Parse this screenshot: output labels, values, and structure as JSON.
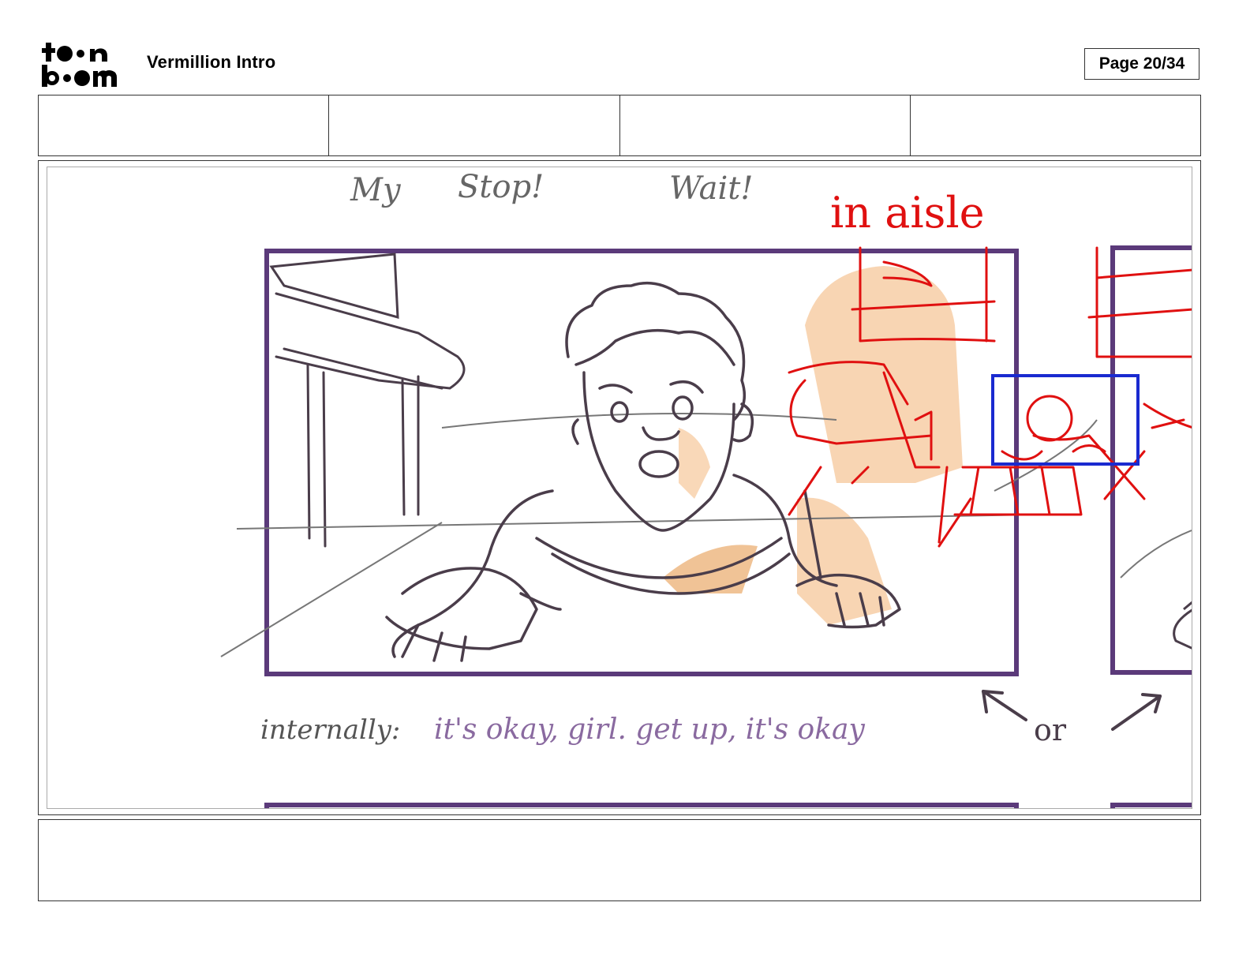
{
  "header": {
    "logo_alt": "toon boom",
    "doc_title": "Vermillion Intro",
    "page_label": "Page 20/34"
  },
  "info_cells": [
    "",
    "",
    "",
    ""
  ],
  "panel": {
    "notes": {
      "dialogue_my": "My",
      "dialogue_stop": "Stop!",
      "dialogue_wait": "Wait!",
      "red_note": "in aisle",
      "internal_label": "internally:",
      "internal_text": "it's okay, girl. get up, it's okay",
      "or_note": "or"
    },
    "colors": {
      "frame": "#5b3a7a",
      "pencil": "#4a3d4a",
      "skin": "#f6c79a",
      "red_markup": "#e01010",
      "blue_markup": "#1a2ad0",
      "dialogue_text": "#666666",
      "internal_text": "#8a6aa0"
    }
  },
  "caption": {
    "text": ""
  }
}
